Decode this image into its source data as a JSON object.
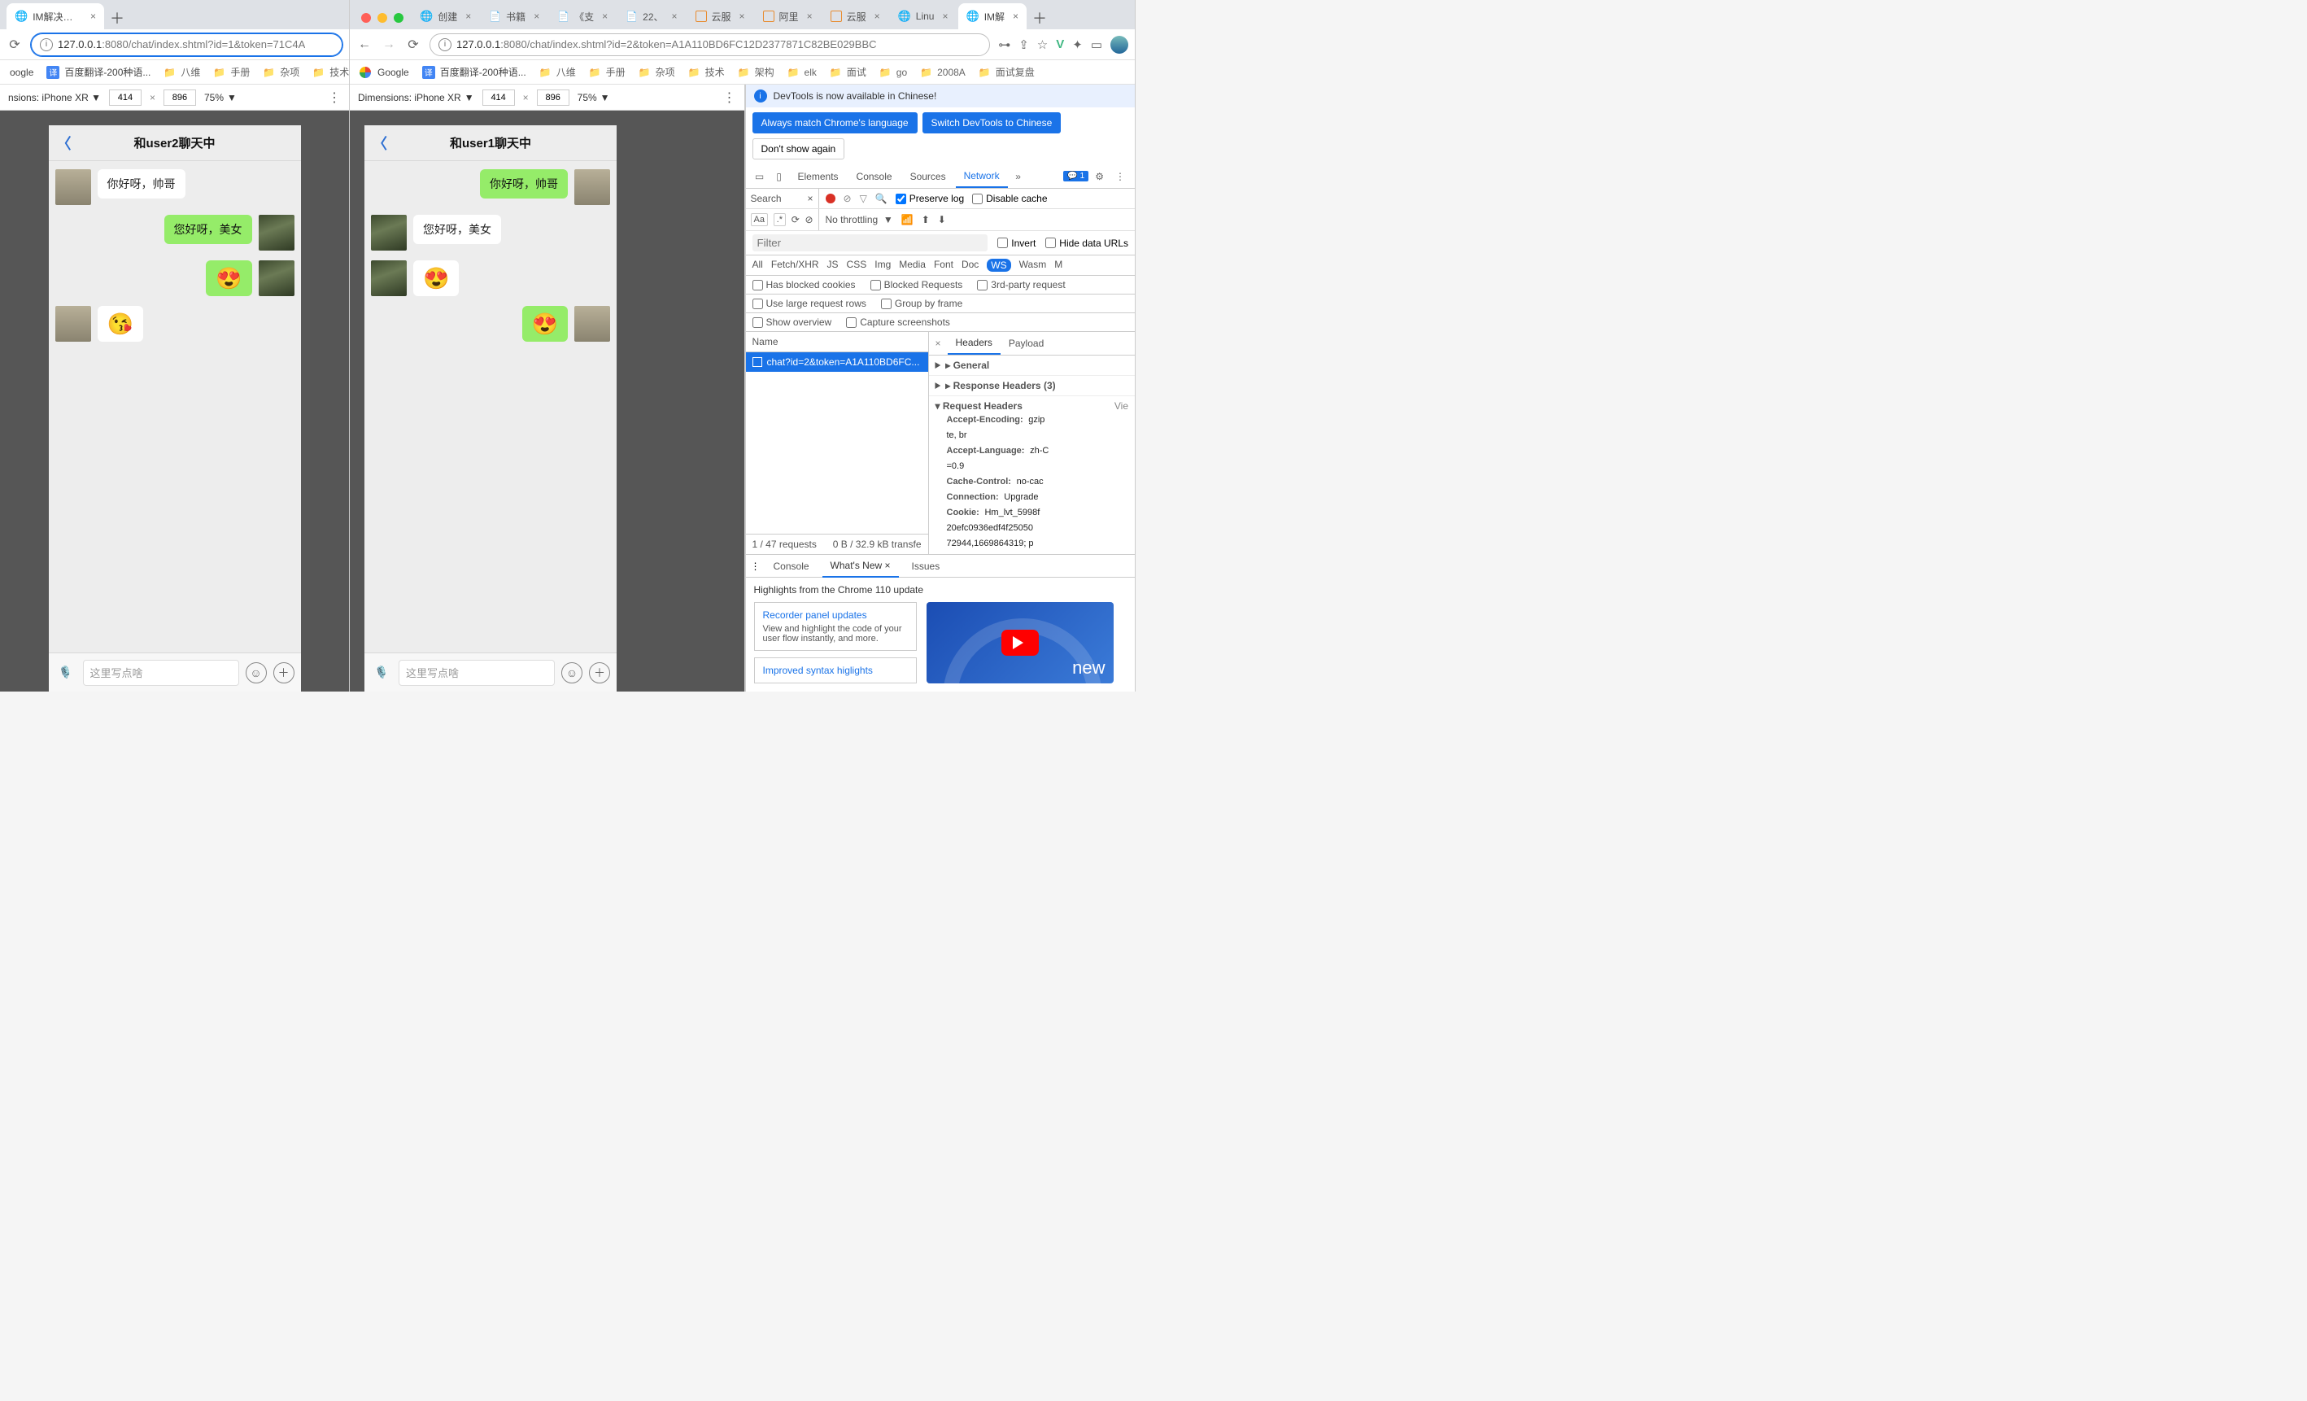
{
  "win1": {
    "tab_title": "IM解决方案",
    "url_prefix": "127.0.0.1",
    "url_rest": ":8080/chat/index.shtml?id=1&token=71C4A",
    "bookmarks": [
      "oogle",
      "百度翻译-200种语...",
      "八维",
      "手册",
      "杂项",
      "技术"
    ],
    "device": {
      "name": "Dimensions: iPhone XR",
      "w": "414",
      "h": "896",
      "zoom": "75%"
    },
    "chat_title": "和user2聊天中",
    "input_placeholder": "这里写点啥",
    "messages": [
      {
        "side": "l",
        "avatar": "cat",
        "type": "text",
        "text": "你好呀，帅哥"
      },
      {
        "side": "r",
        "avatar": "grass",
        "type": "text",
        "text": "您好呀，美女"
      },
      {
        "side": "r",
        "avatar": "grass",
        "type": "emoji",
        "text": "😍"
      },
      {
        "side": "l",
        "avatar": "cat",
        "type": "emoji",
        "text": "😘"
      }
    ]
  },
  "win2": {
    "tabs": [
      {
        "ic": "g",
        "t": "创建",
        "act": false
      },
      {
        "ic": "f",
        "t": "书籍",
        "act": false
      },
      {
        "ic": "f",
        "t": "《支",
        "act": false
      },
      {
        "ic": "f",
        "t": "22、",
        "act": false
      },
      {
        "ic": "b",
        "t": "云服",
        "act": false
      },
      {
        "ic": "b",
        "t": "阿里",
        "act": false
      },
      {
        "ic": "b",
        "t": "云服",
        "act": false
      },
      {
        "ic": "g",
        "t": "Linu",
        "act": false
      },
      {
        "ic": "g",
        "t": "IM解",
        "act": true
      }
    ],
    "url_prefix": "127.0.0.1",
    "url_rest": ":8080/chat/index.shtml?id=2&token=A1A110BD6FC12D2377871C82BE029BBC",
    "bookmarks": [
      "Google",
      "百度翻译-200种语...",
      "八维",
      "手册",
      "杂项",
      "技术",
      "架构",
      "elk",
      "面试",
      "go",
      "2008A",
      "面试复盘"
    ],
    "device": {
      "name": "Dimensions: iPhone XR",
      "w": "414",
      "h": "896",
      "zoom": "75%"
    },
    "chat_title": "和user1聊天中",
    "input_placeholder": "这里写点啥",
    "messages": [
      {
        "side": "r",
        "avatar": "cat",
        "type": "text",
        "text": "你好呀，帅哥"
      },
      {
        "side": "l",
        "avatar": "grass",
        "type": "text",
        "text": "您好呀，美女"
      },
      {
        "side": "l",
        "avatar": "grass",
        "type": "emoji",
        "text": "😍"
      },
      {
        "side": "r",
        "avatar": "cat",
        "type": "emoji",
        "text": "😍"
      }
    ]
  },
  "devtools": {
    "banner": "DevTools is now available in Chinese!",
    "btn_match": "Always match Chrome's language",
    "btn_switch": "Switch DevTools to Chinese",
    "btn_dont": "Don't show again",
    "panels": [
      "Elements",
      "Console",
      "Sources",
      "Network"
    ],
    "active_panel": "Network",
    "issues_count": "1",
    "search_label": "Search",
    "preserve_log": "Preserve log",
    "disable_cache": "Disable cache",
    "throttling": "No throttling",
    "filter_placeholder": "Filter",
    "invert": "Invert",
    "hide_urls": "Hide data URLs",
    "types": [
      "All",
      "Fetch/XHR",
      "JS",
      "CSS",
      "Img",
      "Media",
      "Font",
      "Doc",
      "WS",
      "Wasm",
      "M"
    ],
    "active_type": "WS",
    "opt_blocked_cookies": "Has blocked cookies",
    "opt_blocked_req": "Blocked Requests",
    "opt_3rd": "3rd-party request",
    "opt_large": "Use large request rows",
    "opt_group": "Group by frame",
    "opt_overview": "Show overview",
    "opt_capture": "Capture screenshots",
    "list_header": "Name",
    "request_name": "chat?id=2&token=A1A110BD6FC...",
    "status_left": "1 / 47 requests",
    "status_right": "0 B / 32.9 kB transfe",
    "detail_tabs": [
      "Headers",
      "Payload"
    ],
    "active_detail": "Headers",
    "sec_general": "General",
    "sec_resp": "Response Headers (3)",
    "sec_req": "Request Headers",
    "sec_req_view": "Vie",
    "headers": [
      {
        "k": "Accept-Encoding:",
        "v": "gzip"
      },
      {
        "k": "",
        "v": "te, br"
      },
      {
        "k": "Accept-Language:",
        "v": "zh-C"
      },
      {
        "k": "",
        "v": "=0.9"
      },
      {
        "k": "Cache-Control:",
        "v": "no-cac"
      },
      {
        "k": "Connection:",
        "v": "Upgrade"
      },
      {
        "k": "Cookie:",
        "v": "Hm_lvt_5998f"
      },
      {
        "k": "",
        "v": "20efc0936edf4f25050"
      },
      {
        "k": "",
        "v": "72944,1669864319; p"
      }
    ],
    "drawer_tabs": [
      "Console",
      "What's New",
      "Issues"
    ],
    "drawer_active": "What's New",
    "highlights": "Highlights from the Chrome 110 update",
    "card1_title": "Recorder panel updates",
    "card1_body": "View and highlight the code of your user flow instantly, and more.",
    "card2_title": "Improved syntax higlights",
    "video_label": "new"
  },
  "nav_sensions": "nsions:"
}
